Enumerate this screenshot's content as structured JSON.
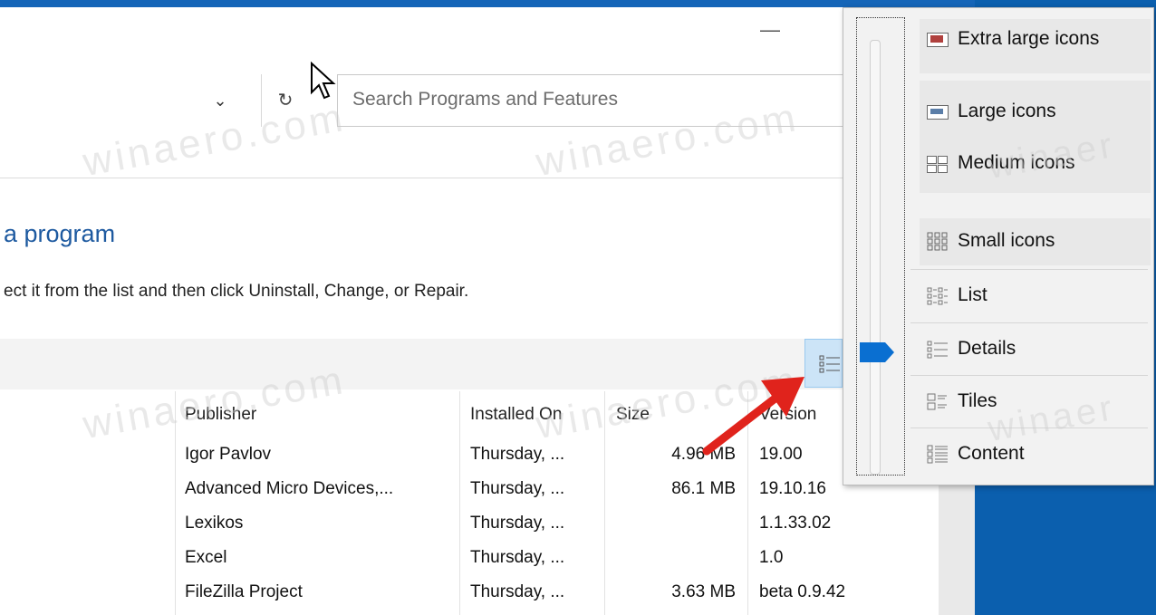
{
  "window": {
    "minimize_glyph": "—",
    "refresh_glyph": "↻",
    "chevron_glyph": "⌄",
    "search_placeholder": "Search Programs and Features"
  },
  "page": {
    "title": "a program",
    "instruction": "ect it from the list and then click Uninstall, Change, or Repair."
  },
  "table": {
    "columns": [
      "Publisher",
      "Installed On",
      "Size",
      "Version"
    ],
    "rows": [
      {
        "publisher": "Igor Pavlov",
        "installed_on": "Thursday, ...",
        "size": "4.96 MB",
        "version": "19.00"
      },
      {
        "publisher": "Advanced Micro Devices,...",
        "installed_on": "Thursday, ...",
        "size": "86.1 MB",
        "version": "19.10.16"
      },
      {
        "publisher": "Lexikos",
        "installed_on": "Thursday, ...",
        "size": "",
        "version": "1.1.33.02"
      },
      {
        "publisher": "Excel",
        "installed_on": "Thursday, ...",
        "size": "",
        "version": "1.0"
      },
      {
        "publisher": "FileZilla Project",
        "installed_on": "Thursday, ...",
        "size": "3.63 MB",
        "version": "beta 0.9.42"
      }
    ]
  },
  "view_menu": {
    "items": [
      {
        "label": "Extra large icons",
        "icon": "extra-large-icons-icon"
      },
      {
        "label": "Large icons",
        "icon": "large-icons-icon"
      },
      {
        "label": "Medium icons",
        "icon": "medium-icons-icon"
      },
      {
        "label": "Small icons",
        "icon": "small-icons-icon"
      },
      {
        "label": "List",
        "icon": "list-icon"
      },
      {
        "label": "Details",
        "icon": "details-icon"
      },
      {
        "label": "Tiles",
        "icon": "tiles-icon"
      },
      {
        "label": "Content",
        "icon": "content-icon"
      }
    ],
    "selected": "Details"
  },
  "watermark": "winaero.com",
  "colors": {
    "title_blue": "#1e5aa0",
    "slider_thumb": "#0a6fd1",
    "arrow_red": "#e0231c",
    "desktop_blue": "#0b5fae"
  }
}
